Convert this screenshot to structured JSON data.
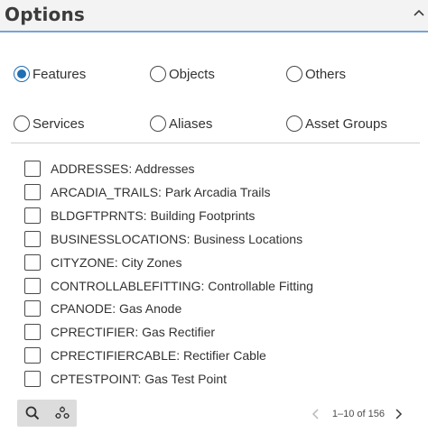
{
  "header": {
    "title": "Options"
  },
  "radios": [
    {
      "label": "Features",
      "selected": true
    },
    {
      "label": "Objects",
      "selected": false
    },
    {
      "label": "Others",
      "selected": false
    },
    {
      "label": "Services",
      "selected": false
    },
    {
      "label": "Aliases",
      "selected": false
    },
    {
      "label": "Asset Groups",
      "selected": false
    }
  ],
  "items": [
    {
      "label": "ADDRESSES: Addresses",
      "checked": false
    },
    {
      "label": "ARCADIA_TRAILS: Park Arcadia Trails",
      "checked": false
    },
    {
      "label": "BLDGFTPRNTS: Building Footprints",
      "checked": false
    },
    {
      "label": "BUSINESSLOCATIONS: Business Locations",
      "checked": false
    },
    {
      "label": "CITYZONE: City Zones",
      "checked": false
    },
    {
      "label": "CONTROLLABLEFITTING: Controllable Fitting",
      "checked": false
    },
    {
      "label": "CPANODE: Gas Anode",
      "checked": false
    },
    {
      "label": "CPRECTIFIER: Gas Rectifier",
      "checked": false
    },
    {
      "label": "CPRECTIFIERCABLE: Rectifier Cable",
      "checked": false
    },
    {
      "label": "CPTESTPOINT: Gas Test Point",
      "checked": false
    }
  ],
  "pager": {
    "text": "1–10 of 156"
  },
  "icons": {
    "collapse": "chevron-up-icon",
    "search": "search-icon",
    "options": "gear-cluster-icon",
    "prev": "chevron-left-icon",
    "next": "chevron-right-icon"
  },
  "colors": {
    "accent": "#1f6fb2",
    "header_border": "#78a4d4",
    "header_bg": "#f3f3f3"
  }
}
